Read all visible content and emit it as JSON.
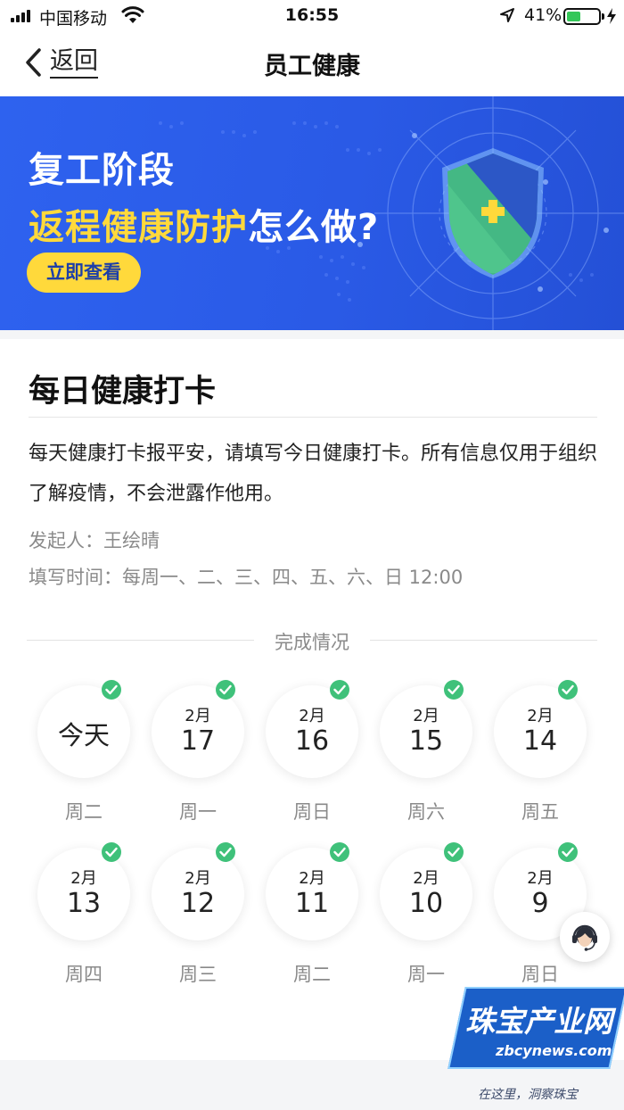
{
  "status_bar": {
    "carrier": "中国移动",
    "time": "16:55",
    "battery": "41%"
  },
  "nav": {
    "back_label": "返回",
    "title": "员工健康"
  },
  "banner": {
    "line1": "复工阶段",
    "line2_highlight": "返程健康防护",
    "line2_rest": "怎么做?",
    "button_label": "立即查看",
    "colors": {
      "background": "#2e62ef",
      "highlight": "#ffd93b"
    }
  },
  "card": {
    "title": "每日健康打卡",
    "description": "每天健康打卡报平安，请填写今日健康打卡。所有信息仅用于组织了解疫情，不会泄露作他用。",
    "initiator": "发起人：王绘晴",
    "fill_time": "填写时间：每周一、二、三、四、五、六、日   12:00",
    "progress_title": "完成情况"
  },
  "days": [
    {
      "label": "今天",
      "month": "",
      "date": "",
      "weekday": "周二",
      "done": true
    },
    {
      "label": "",
      "month": "2月",
      "date": "17",
      "weekday": "周一",
      "done": true
    },
    {
      "label": "",
      "month": "2月",
      "date": "16",
      "weekday": "周日",
      "done": true
    },
    {
      "label": "",
      "month": "2月",
      "date": "15",
      "weekday": "周六",
      "done": true
    },
    {
      "label": "",
      "month": "2月",
      "date": "14",
      "weekday": "周五",
      "done": true
    },
    {
      "label": "",
      "month": "2月",
      "date": "13",
      "weekday": "周四",
      "done": true
    },
    {
      "label": "",
      "month": "2月",
      "date": "12",
      "weekday": "周三",
      "done": true
    },
    {
      "label": "",
      "month": "2月",
      "date": "11",
      "weekday": "周二",
      "done": true
    },
    {
      "label": "",
      "month": "2月",
      "date": "10",
      "weekday": "周一",
      "done": true
    },
    {
      "label": "",
      "month": "2月",
      "date": "9",
      "weekday": "周日",
      "done": true
    }
  ],
  "watermark": {
    "title": "珠宝产业网",
    "url": "zbcynews.com",
    "slogan": "在这里，洞察珠宝"
  },
  "icons": [
    "signal-icon",
    "wifi-icon",
    "location-arrow-icon",
    "battery-icon",
    "charging-icon",
    "back-chevron-icon",
    "shield-plus-icon",
    "check-icon",
    "customer-service-icon"
  ]
}
